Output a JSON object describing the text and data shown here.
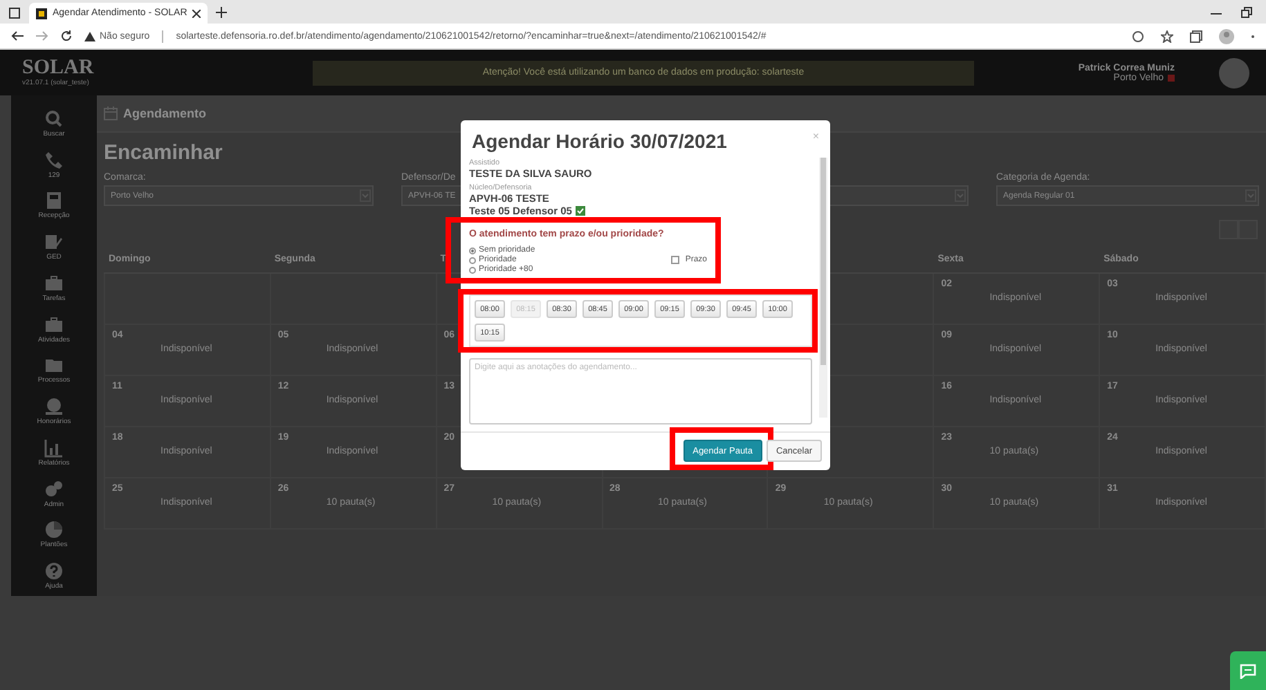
{
  "browser": {
    "tab_title": "Agendar Atendimento - SOLAR",
    "security_label": "Não seguro",
    "url": "solarteste.defensoria.ro.def.br/atendimento/agendamento/210621001542/retorno/?encaminhar=true&next=/atendimento/210621001542/#"
  },
  "header": {
    "logo": "SOLAR",
    "version": "v21.07.1 (solar_teste)",
    "banner": "Atenção! Você está utilizando um banco de dados em produção: solarteste",
    "user_name": "Patrick Correa Muniz",
    "user_location": "Porto Velho"
  },
  "sidebar": {
    "items": [
      {
        "label": "Buscar"
      },
      {
        "label": "129"
      },
      {
        "label": "Recepção"
      },
      {
        "label": "GED"
      },
      {
        "label": "Tarefas"
      },
      {
        "label": "Atividades"
      },
      {
        "label": "Processos"
      },
      {
        "label": "Honorários"
      },
      {
        "label": "Relatórios"
      },
      {
        "label": "Admin"
      },
      {
        "label": "Plantões"
      },
      {
        "label": "Ajuda"
      }
    ]
  },
  "page": {
    "section": "Agendamento",
    "title": "Encaminhar",
    "fields": [
      {
        "label": "Comarca:",
        "value": "Porto Velho"
      },
      {
        "label": "Defensor/De",
        "value": "APVH-06 TE"
      },
      {
        "label": "Categoria de Agenda:",
        "value": "Agenda Regular 01"
      }
    ]
  },
  "calendar": {
    "columns": {
      "sunday": "Domingo",
      "monday": "Segunda",
      "tuesday": "T",
      "friday": "Sexta",
      "saturday": "Sábado"
    },
    "weeks": [
      {
        "friday": {
          "day": "02",
          "status": "Indisponível"
        },
        "saturday": {
          "day": "03",
          "status": "Indisponível"
        }
      },
      {
        "sunday": {
          "day": "04",
          "status": "Indisponível"
        },
        "monday": {
          "day": "05",
          "status": "Indisponível"
        },
        "tuesday": {
          "day": "06"
        },
        "friday": {
          "day": "09",
          "status": "Indisponível"
        },
        "saturday": {
          "day": "10",
          "status": "Indisponível"
        }
      },
      {
        "sunday": {
          "day": "11",
          "status": "Indisponível"
        },
        "monday": {
          "day": "12",
          "status": "Indisponível"
        },
        "tuesday": {
          "day": "13"
        },
        "friday": {
          "day": "16",
          "status": "Indisponível"
        },
        "saturday": {
          "day": "17",
          "status": "Indisponível"
        }
      },
      {
        "sunday": {
          "day": "18",
          "status": "Indisponível"
        },
        "monday": {
          "day": "19",
          "status": "Indisponível"
        },
        "tuesday": {
          "day": "20"
        },
        "friday": {
          "day": "23",
          "status": "10 pauta(s)"
        },
        "saturday": {
          "day": "24",
          "status": "Indisponível"
        }
      },
      {
        "sunday": {
          "day": "25",
          "status": "Indisponível"
        },
        "monday": {
          "day": "26",
          "status": "10 pauta(s)"
        },
        "tuesday": {
          "day": "27",
          "status": "10 pauta(s)"
        },
        "wednesday": {
          "day": "28",
          "status": "10 pauta(s)"
        },
        "thursday": {
          "day": "29",
          "status": "10 pauta(s)"
        },
        "friday": {
          "day": "30",
          "status": "10 pauta(s)"
        },
        "saturday": {
          "day": "31",
          "status": "Indisponível"
        }
      }
    ]
  },
  "modal": {
    "title": "Agendar Horário 30/07/2021",
    "close": "×",
    "assistido_label": "Assistido",
    "assistido": "TESTE DA SILVA SAURO",
    "nucleo_label": "Núcleo/Defensoria",
    "nucleo": "APVH-06 TESTE",
    "defensor": "Teste 05 Defensor 05",
    "priority": {
      "highlighted": true,
      "question": "O atendimento tem prazo e/ou prioridade?",
      "options": [
        {
          "label": "Sem prioridade",
          "selected": true
        },
        {
          "label": "Prioridade",
          "selected": false
        },
        {
          "label": "Prioridade +80",
          "selected": false
        }
      ],
      "deadline": {
        "label": "Prazo",
        "checked": false
      }
    },
    "time_slots": {
      "highlighted": true,
      "slots": [
        {
          "time": "08:00",
          "disabled": false
        },
        {
          "time": "08:15",
          "disabled": true
        },
        {
          "time": "08:30",
          "disabled": false
        },
        {
          "time": "08:45",
          "disabled": false
        },
        {
          "time": "09:00",
          "disabled": false
        },
        {
          "time": "09:15",
          "disabled": false
        },
        {
          "time": "09:30",
          "disabled": false
        },
        {
          "time": "09:45",
          "disabled": false
        },
        {
          "time": "10:00",
          "disabled": false
        },
        {
          "time": "10:15",
          "disabled": false
        }
      ]
    },
    "notes": {
      "placeholder": "Digite aqui as anotações do agendamento..."
    },
    "buttons": [
      {
        "label": "Agendar Pauta",
        "kind": "primary",
        "highlighted": true
      },
      {
        "label": "Cancelar",
        "kind": "default",
        "highlighted": false
      }
    ]
  }
}
